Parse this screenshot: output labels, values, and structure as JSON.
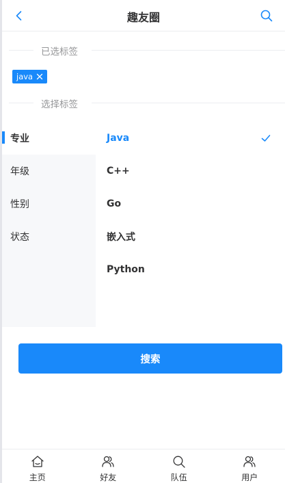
{
  "navbar": {
    "title": "趣友圈",
    "back_icon": "chevron-left-icon",
    "search_icon": "search-icon"
  },
  "selected_section": {
    "title": "已选标签",
    "tags": [
      {
        "label": "java",
        "close_icon": "close-icon"
      }
    ]
  },
  "choose_section": {
    "title": "选择标签"
  },
  "tree_select": {
    "categories": [
      {
        "label": "专业",
        "active": true
      },
      {
        "label": "年级",
        "active": false
      },
      {
        "label": "性别",
        "active": false
      },
      {
        "label": "状态",
        "active": false
      }
    ],
    "options": [
      {
        "label": "Java",
        "selected": true
      },
      {
        "label": "C++",
        "selected": false
      },
      {
        "label": "Go",
        "selected": false
      },
      {
        "label": "嵌入式",
        "selected": false
      },
      {
        "label": "Python",
        "selected": false
      }
    ],
    "check_icon": "check-icon"
  },
  "search_button": {
    "label": "搜索"
  },
  "tabbar": {
    "items": [
      {
        "label": "主页",
        "icon": "home-icon"
      },
      {
        "label": "好友",
        "icon": "friends-icon"
      },
      {
        "label": "队伍",
        "icon": "search-icon"
      },
      {
        "label": "用户",
        "icon": "user-icon"
      }
    ]
  },
  "colors": {
    "accent": "#1989fa",
    "sidebar_bg": "#f7f8fa",
    "text": "#323233",
    "muted": "#969799"
  }
}
